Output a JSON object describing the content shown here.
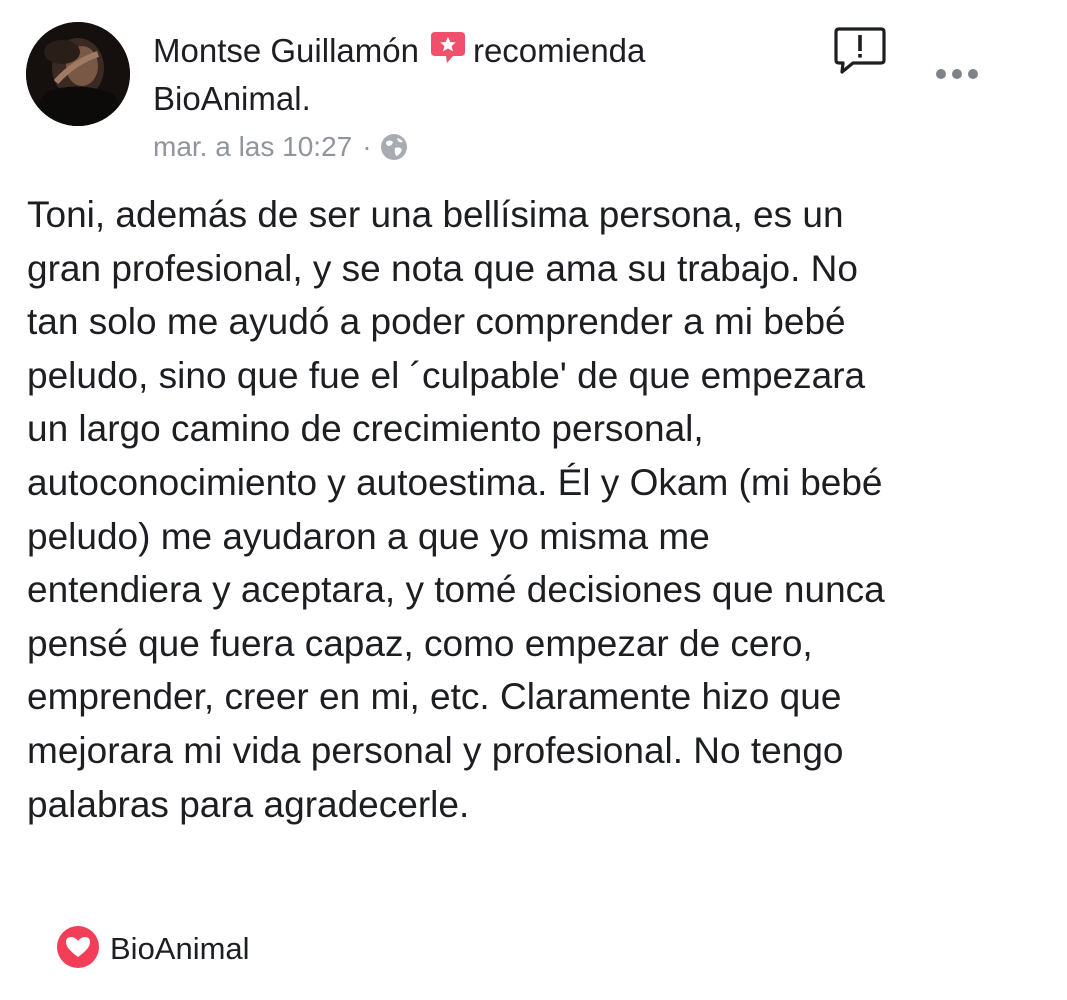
{
  "post": {
    "author_name": "Montse Guillamón",
    "action_text": "recomienda",
    "page_name": "BioAnimal.",
    "timestamp": "mar. a las 10:27",
    "separator": "·",
    "privacy_icon": "globe-icon",
    "recommend_icon": "recommend-star-icon",
    "body": "Toni, además de ser una bellísima persona, es un\ngran profesional, y se nota que ama su trabajo. No\ntan solo me ayudó a poder comprender a mi bebé\npeludo, sino que fue el ´culpable' de que empezara\nun largo camino de crecimiento personal,\nautoconocimiento y autoestima. Él y Okam (mi bebé\npeludo) me ayudaron a que yo misma me\nentendiera y aceptara, y tomé decisiones que nunca\npensé que fuera capaz, como empezar de cero,\nemprender, creer en mi, etc. Claramente hizo que\nmejorara mi vida personal y profesional. No tengo\npalabras para agradecerle.",
    "page_tag": "BioAnimal"
  },
  "icons": {
    "report": "report-icon",
    "more": "more-options-icon",
    "heart": "heart-icon"
  },
  "colors": {
    "recommend_accent": "#f0506e",
    "heart_accent": "#f33e58",
    "meta_gray": "#90949c",
    "text": "#1c1e21"
  }
}
